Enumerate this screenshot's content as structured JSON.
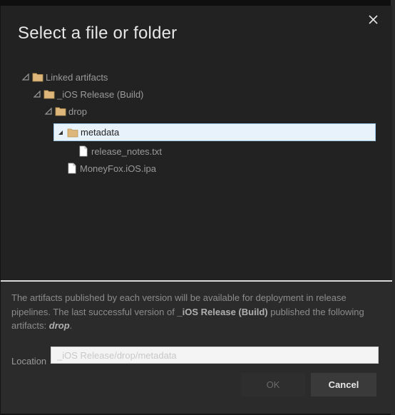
{
  "dialog": {
    "title": "Select a file or folder",
    "close_icon": "close-icon"
  },
  "tree": {
    "items": [
      {
        "label": "Linked artifacts",
        "type": "folder",
        "expanded": true,
        "depth": 0
      },
      {
        "label": "_iOS Release (Build)",
        "type": "folder",
        "expanded": true,
        "depth": 1
      },
      {
        "label": "drop",
        "type": "folder",
        "expanded": true,
        "depth": 2
      },
      {
        "label": "metadata",
        "type": "folder",
        "expanded": true,
        "selected": true,
        "depth": 3
      },
      {
        "label": "release_notes.txt",
        "type": "file",
        "depth": 4
      },
      {
        "label": "MoneyFox.iOS.ipa",
        "type": "file",
        "depth": 3
      }
    ]
  },
  "footer": {
    "info_part1": "The artifacts published by each version will be available for deployment in release pipelines. The last successful version of ",
    "info_build": "_iOS Release (Build)",
    "info_part2": " published the following artifacts: ",
    "info_artifact": "drop",
    "info_end": ".",
    "location_label": "Location",
    "location_value": "_iOS Release/drop/metadata",
    "ok_label": "OK",
    "cancel_label": "Cancel"
  },
  "colors": {
    "dialog_bg": "#222222",
    "footer_bg": "#2b2b2b",
    "selection_bg": "#e8f2fb",
    "folder": "#dcb67a"
  }
}
